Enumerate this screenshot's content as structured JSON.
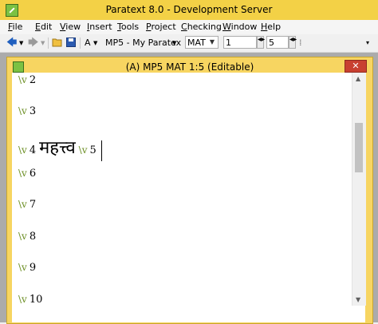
{
  "window": {
    "title": "Paratext 8.0 - Development Server"
  },
  "menu": [
    {
      "label": "File",
      "u": "F",
      "rest": "ile"
    },
    {
      "label": "Edit",
      "u": "E",
      "rest": "dit"
    },
    {
      "label": "View",
      "u": "V",
      "rest": "iew"
    },
    {
      "label": "Insert",
      "u": "I",
      "rest": "nsert"
    },
    {
      "label": "Tools",
      "u": "T",
      "rest": "ools"
    },
    {
      "label": "Project",
      "u": "P",
      "rest": "roject"
    },
    {
      "label": "Checking",
      "u": "C",
      "rest": "hecking"
    },
    {
      "label": "Window",
      "u": "W",
      "rest": "indow"
    },
    {
      "label": "Help",
      "u": "H",
      "rest": "elp"
    }
  ],
  "toolbar": {
    "back_arrow": "🡄",
    "forward_arrow": "🡆",
    "font_label": "A",
    "project_combo": "MP5  - My Paratex",
    "book_combo": "MAT",
    "chapter_value": "1",
    "verse_value": "5"
  },
  "child_window": {
    "title": "(A) MP5 MAT 1:5 (Editable)",
    "close": "✕"
  },
  "editor": {
    "marker": "\\v",
    "verses": [
      {
        "num": "2"
      },
      {
        "num": "3"
      },
      {
        "num": "4",
        "word": "महत्त्व",
        "next_num": "5"
      },
      {
        "num": "6"
      },
      {
        "num": "7"
      },
      {
        "num": "8"
      },
      {
        "num": "9"
      },
      {
        "num": "10"
      }
    ]
  },
  "colors": {
    "titlebar": "#f3d146",
    "child_titlebar": "#f7d561",
    "verse_marker": "#6b8e23",
    "close_button": "#c84031"
  }
}
